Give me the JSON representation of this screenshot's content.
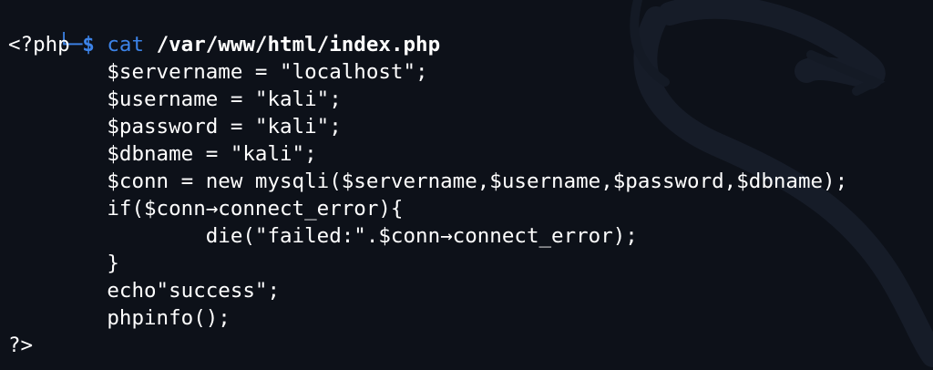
{
  "prompt": {
    "corner": "└─",
    "dollar": "$",
    "command": "cat",
    "argument": "/var/www/html/index.php"
  },
  "code_lines": [
    "<?php",
    "        $servername = \"localhost\";",
    "        $username = \"kali\";",
    "        $password = \"kali\";",
    "        $dbname = \"kali\";",
    "        $conn = new mysqli($servername,$username,$password,$dbname);",
    "        if($conn→connect_error){",
    "                die(\"failed:\".$conn→connect_error);",
    "        }",
    "        echo\"success\";",
    "        phpinfo();",
    "?>"
  ],
  "colors": {
    "background": "#0d1119",
    "prompt_blue": "#3c83e8",
    "text": "#ffffff"
  }
}
